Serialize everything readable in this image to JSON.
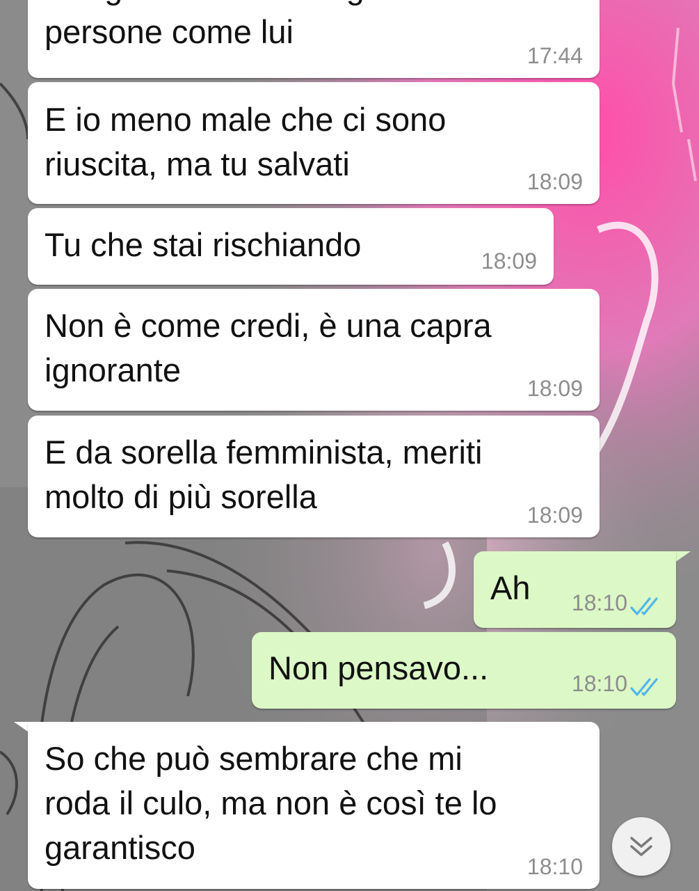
{
  "colors": {
    "incoming_bubble": "#ffffff",
    "outgoing_bubble": "#dcf8c6",
    "timestamp": "#8d8d8d",
    "read_ticks": "#4fb6ec"
  },
  "messages": [
    {
      "id": "m0",
      "direction": "in",
      "text": "bisogna stare alla larga da\npersone come lui",
      "time": "17:44"
    },
    {
      "id": "m1",
      "direction": "in",
      "text": "E io meno male che ci sono\nriuscita, ma tu salvati",
      "time": "18:09"
    },
    {
      "id": "m2",
      "direction": "in",
      "text": "Tu che stai rischiando",
      "time": "18:09"
    },
    {
      "id": "m3",
      "direction": "in",
      "text": "Non è come credi, è una capra\nignorante",
      "time": "18:09"
    },
    {
      "id": "m4",
      "direction": "in",
      "text": "E da sorella femminista, meriti\nmolto di più sorella",
      "time": "18:09"
    },
    {
      "id": "m5",
      "direction": "out",
      "text": "Ah",
      "time": "18:10",
      "status": "read",
      "status_icon": "double-check-icon"
    },
    {
      "id": "m6",
      "direction": "out",
      "text": "Non pensavo...",
      "time": "18:10",
      "status": "read",
      "status_icon": "double-check-icon"
    },
    {
      "id": "m7",
      "direction": "in",
      "text": "So che può sembrare che mi\nroda il culo, ma non è così te lo\ngarantisco",
      "time": "18:10"
    }
  ],
  "scroll_to_bottom": {
    "icon": "double-chevron-down-icon"
  }
}
